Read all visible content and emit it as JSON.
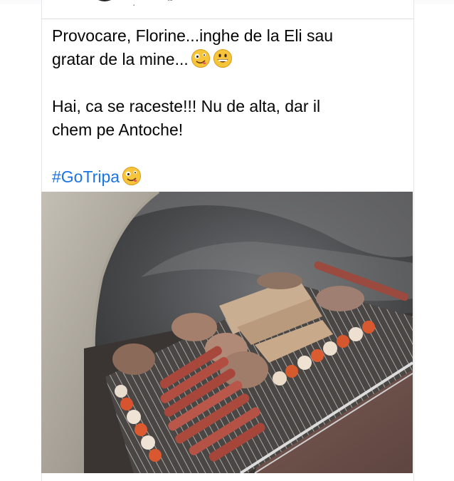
{
  "post": {
    "lines": [
      "Provocare, Florine...inghe de la Eli sau",
      "gratar de la mine..."
    ],
    "lines2": [
      "Hai, ca se raceste!!! Nu de alta, dar il",
      "chem pe Antoche!"
    ],
    "hashtag": "#GoTripa",
    "emojis": [
      "zany-face-emoji",
      "grinning-face-emoji"
    ]
  },
  "header": {
    "meta": "ııı ·",
    "icons": [
      "avatar",
      "globe-icon"
    ]
  },
  "photo": {
    "subject": "grill-with-meat-skewers",
    "colors": {
      "smoke": "#4d4e50",
      "stone": "#b5b0a6",
      "grate": "#d9d9d9"
    }
  }
}
